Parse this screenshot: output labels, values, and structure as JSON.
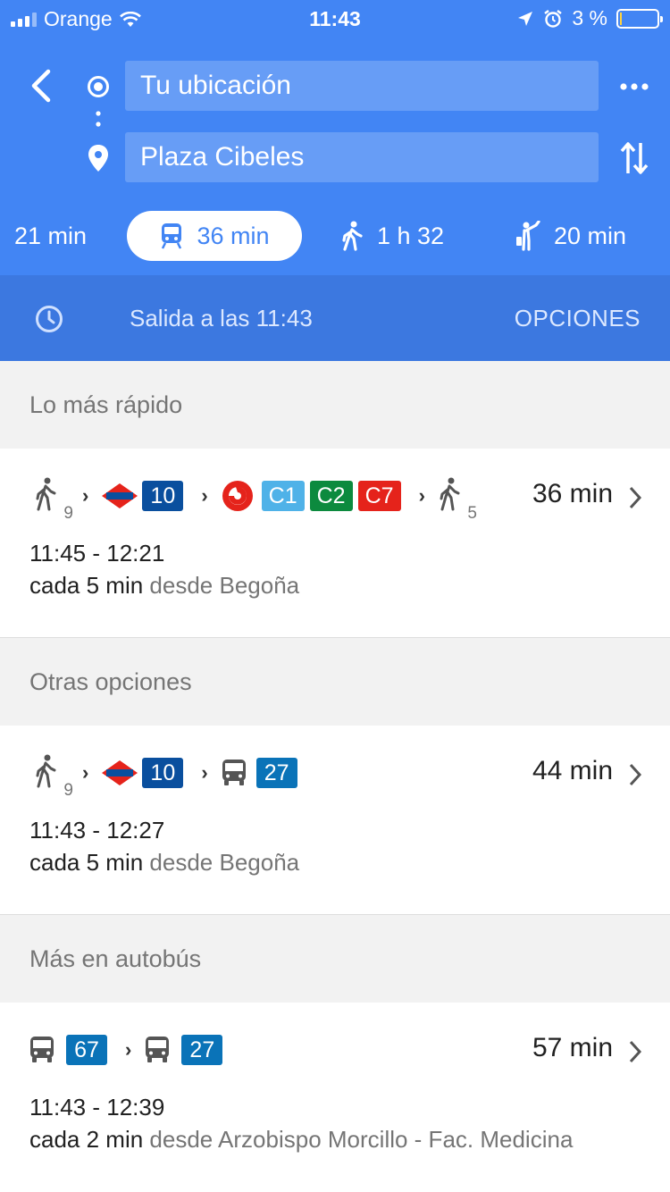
{
  "status_bar": {
    "carrier": "Orange",
    "time": "11:43",
    "battery_text": "3 %",
    "battery_level": 0.03
  },
  "search": {
    "origin": "Tu ubicación",
    "destination": "Plaza Cibeles"
  },
  "modes": {
    "car": "21 min",
    "transit": "36 min",
    "walk": "1 h 32",
    "ride": "20 min",
    "selected": "transit"
  },
  "departure": {
    "text": "Salida a las 11:43",
    "options_label": "OPCIONES"
  },
  "sections": [
    {
      "title": "Lo más rápido",
      "routes": [
        {
          "duration": "36 min",
          "times": "11:45 - 12:21",
          "freq": "cada 5 min",
          "from": "desde Begoña",
          "walk_start": "9",
          "metro_line": "10",
          "cercanias": [
            "C1",
            "C2",
            "C7"
          ],
          "walk_end": "5"
        }
      ]
    },
    {
      "title": "Otras opciones",
      "routes": [
        {
          "duration": "44 min",
          "times": "11:43 - 12:27",
          "freq": "cada 5 min",
          "from": "desde Begoña",
          "walk_start": "9",
          "metro_line": "10",
          "bus_line": "27"
        }
      ]
    },
    {
      "title": "Más en autobús",
      "routes": [
        {
          "duration": "57 min",
          "times": "11:43 - 12:39",
          "freq": "cada 2 min",
          "from": "desde Arzobispo Morcillo - Fac. Medicina",
          "bus_line_1": "67",
          "bus_line_2": "27"
        }
      ]
    }
  ],
  "colors": {
    "header_blue": "#4285f4",
    "depbar_blue": "#3c78e0",
    "metro_blue": "#0a4f9e",
    "cercanias_red": "#e5231b",
    "c1_lightblue": "#4fb2e8",
    "c2_green": "#0c8a3e",
    "c7_red": "#e5231b",
    "bus_blue": "#0a73b8"
  }
}
